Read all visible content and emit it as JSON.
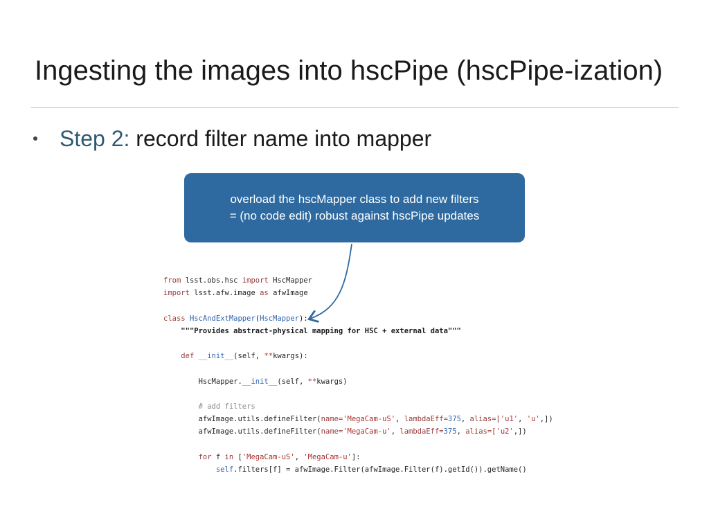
{
  "slide": {
    "title": "Ingesting the images into hscPipe (hscPipe-ization)",
    "bullet": {
      "label": "Step 2:",
      "text": " record filter name into mapper"
    }
  },
  "callout": {
    "line1": "overload the hscMapper class to add new filters",
    "line2": "= (no code edit) robust against hscPipe updates"
  },
  "code": {
    "lines": [
      [
        {
          "t": "from",
          "c": "kw"
        },
        {
          "t": " lsst.obs.hsc "
        },
        {
          "t": "import",
          "c": "kw"
        },
        {
          "t": " HscMapper"
        }
      ],
      [
        {
          "t": "import",
          "c": "kw"
        },
        {
          "t": " lsst.afw.image "
        },
        {
          "t": "as",
          "c": "kw"
        },
        {
          "t": " afwImage"
        }
      ],
      [],
      [
        {
          "t": "class",
          "c": "kw"
        },
        {
          "t": " "
        },
        {
          "t": "HscAndExtMapper",
          "c": "fn"
        },
        {
          "t": "("
        },
        {
          "t": "HscMapper",
          "c": "fn"
        },
        {
          "t": "):"
        }
      ],
      [
        {
          "t": "    "
        },
        {
          "t": "\"\"\"Provides abstract-physical mapping for HSC + external data\"\"\"",
          "c": "docstr"
        }
      ],
      [],
      [
        {
          "t": "    "
        },
        {
          "t": "def",
          "c": "kw"
        },
        {
          "t": " "
        },
        {
          "t": "__init__",
          "c": "fn"
        },
        {
          "t": "(self, "
        },
        {
          "t": "**",
          "c": "kw"
        },
        {
          "t": "kwargs):"
        }
      ],
      [],
      [
        {
          "t": "        HscMapper."
        },
        {
          "t": "__init__",
          "c": "fn"
        },
        {
          "t": "(self, "
        },
        {
          "t": "**",
          "c": "kw"
        },
        {
          "t": "kwargs)"
        }
      ],
      [],
      [
        {
          "t": "        "
        },
        {
          "t": "# add filters",
          "c": "cm"
        }
      ],
      [
        {
          "t": "        afwImage.utils.defineFilter("
        },
        {
          "t": "name=",
          "c": "kw"
        },
        {
          "t": "'MegaCam-uS'",
          "c": "str"
        },
        {
          "t": ", "
        },
        {
          "t": "lambdaEff=",
          "c": "kw"
        },
        {
          "t": "375",
          "c": "fn"
        },
        {
          "t": ", "
        },
        {
          "t": "alias=",
          "c": "kw"
        },
        {
          "t": "['u1'",
          "c": "str"
        },
        {
          "t": ", "
        },
        {
          "t": "'u'",
          "c": "str"
        },
        {
          "t": ",])"
        }
      ],
      [
        {
          "t": "        afwImage.utils.defineFilter("
        },
        {
          "t": "name=",
          "c": "kw"
        },
        {
          "t": "'MegaCam-u'",
          "c": "str"
        },
        {
          "t": ", "
        },
        {
          "t": "lambdaEff=",
          "c": "kw"
        },
        {
          "t": "375",
          "c": "fn"
        },
        {
          "t": ", "
        },
        {
          "t": "alias=",
          "c": "kw"
        },
        {
          "t": "['u2'",
          "c": "str"
        },
        {
          "t": ",])"
        }
      ],
      [],
      [
        {
          "t": "        "
        },
        {
          "t": "for",
          "c": "kw"
        },
        {
          "t": " f "
        },
        {
          "t": "in",
          "c": "kw"
        },
        {
          "t": " ["
        },
        {
          "t": "'MegaCam-uS'",
          "c": "str"
        },
        {
          "t": ", "
        },
        {
          "t": "'MegaCam-u'",
          "c": "str"
        },
        {
          "t": "]:"
        }
      ],
      [
        {
          "t": "            "
        },
        {
          "t": "self",
          "c": "fn"
        },
        {
          "t": ".filters[f] = afwImage.Filter(afwImage.Filter(f).getId()).getName()"
        }
      ]
    ]
  },
  "colors": {
    "callout_bg": "#2e6aa0",
    "step_label": "#2f5a73",
    "keyword": "#9a3b3b",
    "name": "#2f64b0"
  }
}
